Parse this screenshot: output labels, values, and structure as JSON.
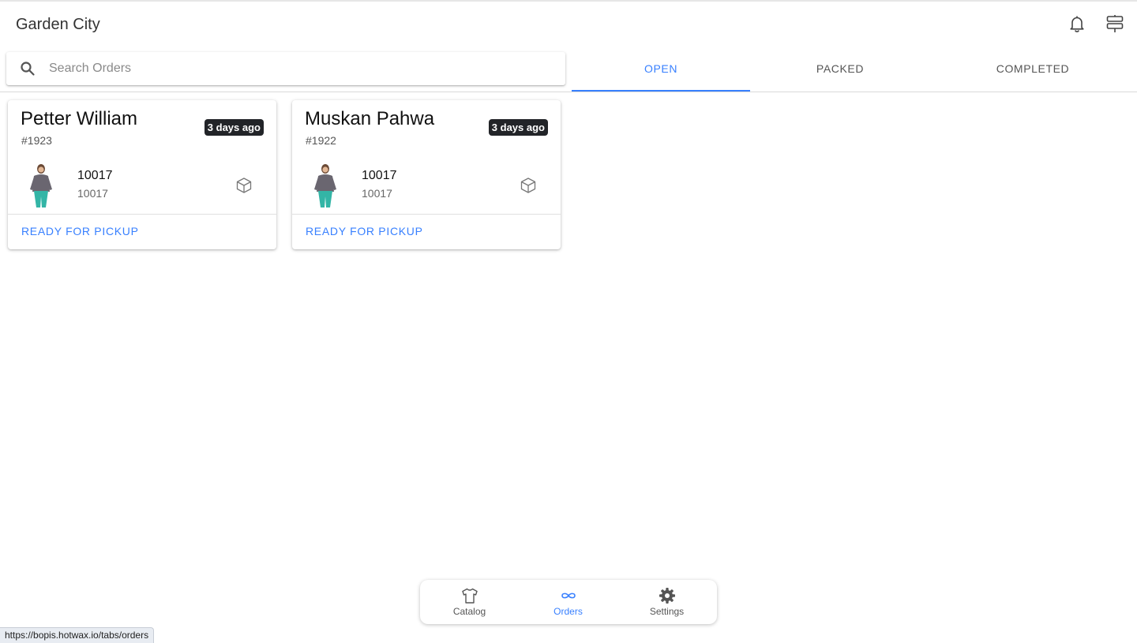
{
  "header": {
    "title": "Garden City",
    "icons": [
      "notifications-icon",
      "stores-icon"
    ]
  },
  "search": {
    "placeholder": "Search Orders",
    "value": ""
  },
  "tabs": [
    {
      "label": "OPEN",
      "active": true
    },
    {
      "label": "PACKED",
      "active": false
    },
    {
      "label": "COMPLETED",
      "active": false
    }
  ],
  "orders": [
    {
      "customer": "Petter William",
      "order_id": "#1923",
      "age": "3 days ago",
      "item": {
        "title": "10017",
        "subtitle": "10017",
        "image": "product-thumbnail"
      },
      "action": "READY FOR PICKUP"
    },
    {
      "customer": "Muskan Pahwa",
      "order_id": "#1922",
      "age": "3 days ago",
      "item": {
        "title": "10017",
        "subtitle": "10017",
        "image": "product-thumbnail"
      },
      "action": "READY FOR PICKUP"
    }
  ],
  "bottom_nav": [
    {
      "label": "Catalog",
      "icon": "shirt-icon",
      "active": false
    },
    {
      "label": "Orders",
      "icon": "infinite-icon",
      "active": true
    },
    {
      "label": "Settings",
      "icon": "gear-icon",
      "active": false
    }
  ],
  "status_bar": {
    "url": "https://bopis.hotwax.io/tabs/orders"
  },
  "colors": {
    "accent": "#3880ff",
    "badge": "#222428",
    "text": "#111111"
  }
}
